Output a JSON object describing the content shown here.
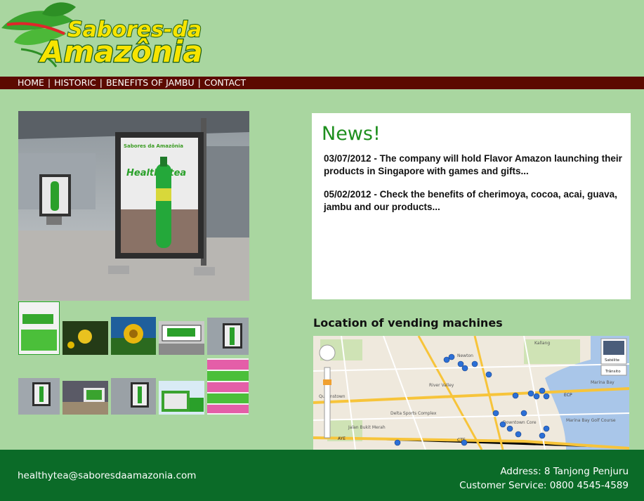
{
  "logo": {
    "line1": "Sabores-da",
    "line2": "Amazônia"
  },
  "nav": [
    {
      "label": "HOME"
    },
    {
      "label": "HISTORIC"
    },
    {
      "label": "BENEFITS OF JAMBU"
    },
    {
      "label": "CONTACT"
    }
  ],
  "nav_separator": "|",
  "main_photo": {
    "poster_brand": "Sabores da Amazônia",
    "poster_product": "Healthy tea"
  },
  "news": {
    "title": "News!",
    "items": [
      {
        "text": "03/07/2012 - The company will hold Flavor Amazon launching their products in Singapore with games and gifts..."
      },
      {
        "text": "05/02/2012 - Check the benefits of cherimoya, cocoa, acai, guava, jambu and our products..."
      }
    ]
  },
  "location": {
    "title": "Location of vending machines",
    "map_controls": {
      "satellite": "Satélite",
      "traffic": "Trânsito"
    },
    "map_labels": [
      "Bukit Timah",
      "Newton",
      "Kallang",
      "River Valley",
      "Queenstown",
      "Marina Bay",
      "ECP",
      "AYE",
      "Downtown Core",
      "CTE",
      "Jalan Bukit Merah",
      "Delta Sports Complex",
      "Marina Bay Golf Course"
    ]
  },
  "footer": {
    "email": "healthytea@saboresdaamazonia.com",
    "address": "Address: 8 Tanjong Penjuru",
    "service": "Customer Service: 0800 4545-4589"
  },
  "colors": {
    "background": "#a9d6a0",
    "nav": "#5c0a00",
    "footer": "#0b6b28",
    "news_title": "#1e8f1e"
  }
}
